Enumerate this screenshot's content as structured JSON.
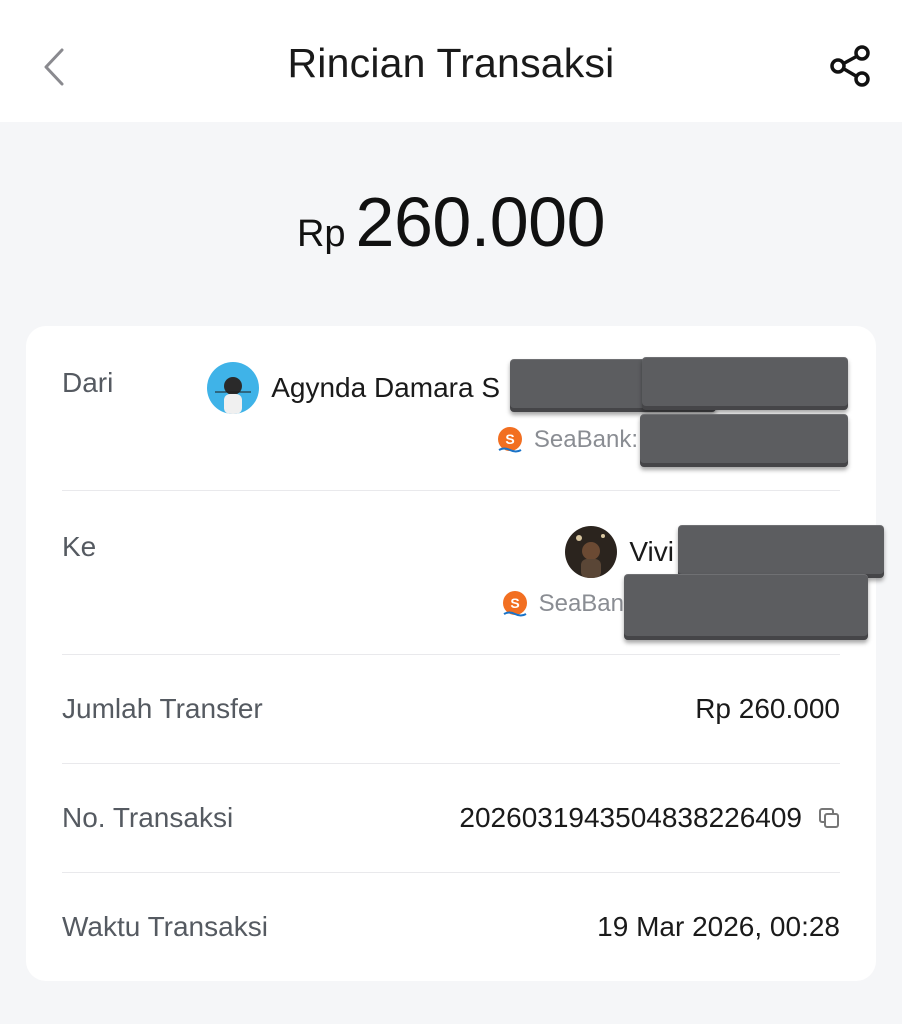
{
  "header": {
    "title": "Rincian Transaksi",
    "back_icon": "chevron-left-icon",
    "share_icon": "share-icon"
  },
  "amount": {
    "currency": "Rp",
    "value": "260.000"
  },
  "details": {
    "from": {
      "label": "Dari",
      "name": "Agynda Damara S",
      "bank": "SeaBank:"
    },
    "to": {
      "label": "Ke",
      "name": "Vivi",
      "bank": "SeaBan"
    },
    "transfer_amount": {
      "label": "Jumlah Transfer",
      "value": "Rp 260.000"
    },
    "transaction_no": {
      "label": "No. Transaksi",
      "value": "2026031943504838226409"
    },
    "transaction_time": {
      "label": "Waktu Transaksi",
      "value": "19 Mar 2026, 00:28"
    }
  },
  "colors": {
    "background": "#f5f6f8",
    "card": "#ffffff",
    "seabank_orange": "#f26f21",
    "redaction": "#5c5d60"
  }
}
